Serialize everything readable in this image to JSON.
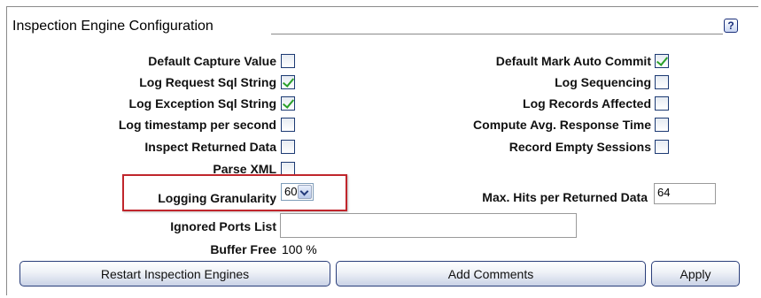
{
  "header": {
    "title": "Inspection Engine Configuration",
    "help_icon": "question-mark-icon",
    "help_glyph": "?"
  },
  "left_options": [
    {
      "label": "Default Capture Value",
      "checked": false
    },
    {
      "label": "Log Request Sql String",
      "checked": true
    },
    {
      "label": "Log Exception Sql String",
      "checked": true
    },
    {
      "label": "Log timestamp per second",
      "checked": false
    },
    {
      "label": "Inspect Returned Data",
      "checked": false
    },
    {
      "label": "Parse XML",
      "checked": false
    }
  ],
  "right_options": [
    {
      "label": "Default Mark Auto Commit",
      "checked": true
    },
    {
      "label": "Log Sequencing",
      "checked": false
    },
    {
      "label": "Log Records Affected",
      "checked": false
    },
    {
      "label": "Compute Avg. Response Time",
      "checked": false
    },
    {
      "label": "Record Empty Sessions",
      "checked": false
    }
  ],
  "logging_granularity": {
    "label": "Logging Granularity",
    "value": "60",
    "highlight_color": "#c0262c"
  },
  "max_hits": {
    "label": "Max. Hits per Returned Data",
    "value": "64"
  },
  "ignored_ports": {
    "label": "Ignored Ports List",
    "value": ""
  },
  "buffer_free": {
    "label": "Buffer Free",
    "value": "100 %"
  },
  "buttons": {
    "restart": "Restart Inspection Engines",
    "add_comments": "Add Comments",
    "apply": "Apply"
  }
}
